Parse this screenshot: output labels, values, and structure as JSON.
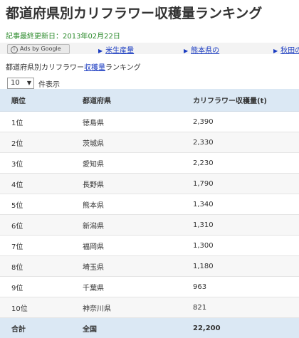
{
  "page": {
    "title": "都道府県別カリフラワー収穫量ランキング",
    "updated": "記事最終更新日：2013年02月22日"
  },
  "ads": {
    "badge": "Ads by Google",
    "links": [
      "米生産量",
      "熊本県の",
      "秋田の"
    ]
  },
  "breadcrumb": {
    "prefix": "都道府県別カリフラワー",
    "link": "収穫量",
    "suffix": "ランキング"
  },
  "controls": {
    "page_size": "10",
    "page_size_label": "件表示"
  },
  "table": {
    "headers": [
      "順位",
      "都道府県",
      "カリフラワー収穫量(t)"
    ],
    "rows": [
      [
        "1位",
        "徳島県",
        "2,390"
      ],
      [
        "2位",
        "茨城県",
        "2,330"
      ],
      [
        "3位",
        "愛知県",
        "2,230"
      ],
      [
        "4位",
        "長野県",
        "1,790"
      ],
      [
        "5位",
        "熊本県",
        "1,340"
      ],
      [
        "6位",
        "新潟県",
        "1,310"
      ],
      [
        "7位",
        "福岡県",
        "1,300"
      ],
      [
        "8位",
        "埼玉県",
        "1,180"
      ],
      [
        "9位",
        "千葉県",
        "963"
      ],
      [
        "10位",
        "神奈川県",
        "821"
      ]
    ],
    "footer": [
      "合計",
      "全国",
      "22,200"
    ]
  }
}
